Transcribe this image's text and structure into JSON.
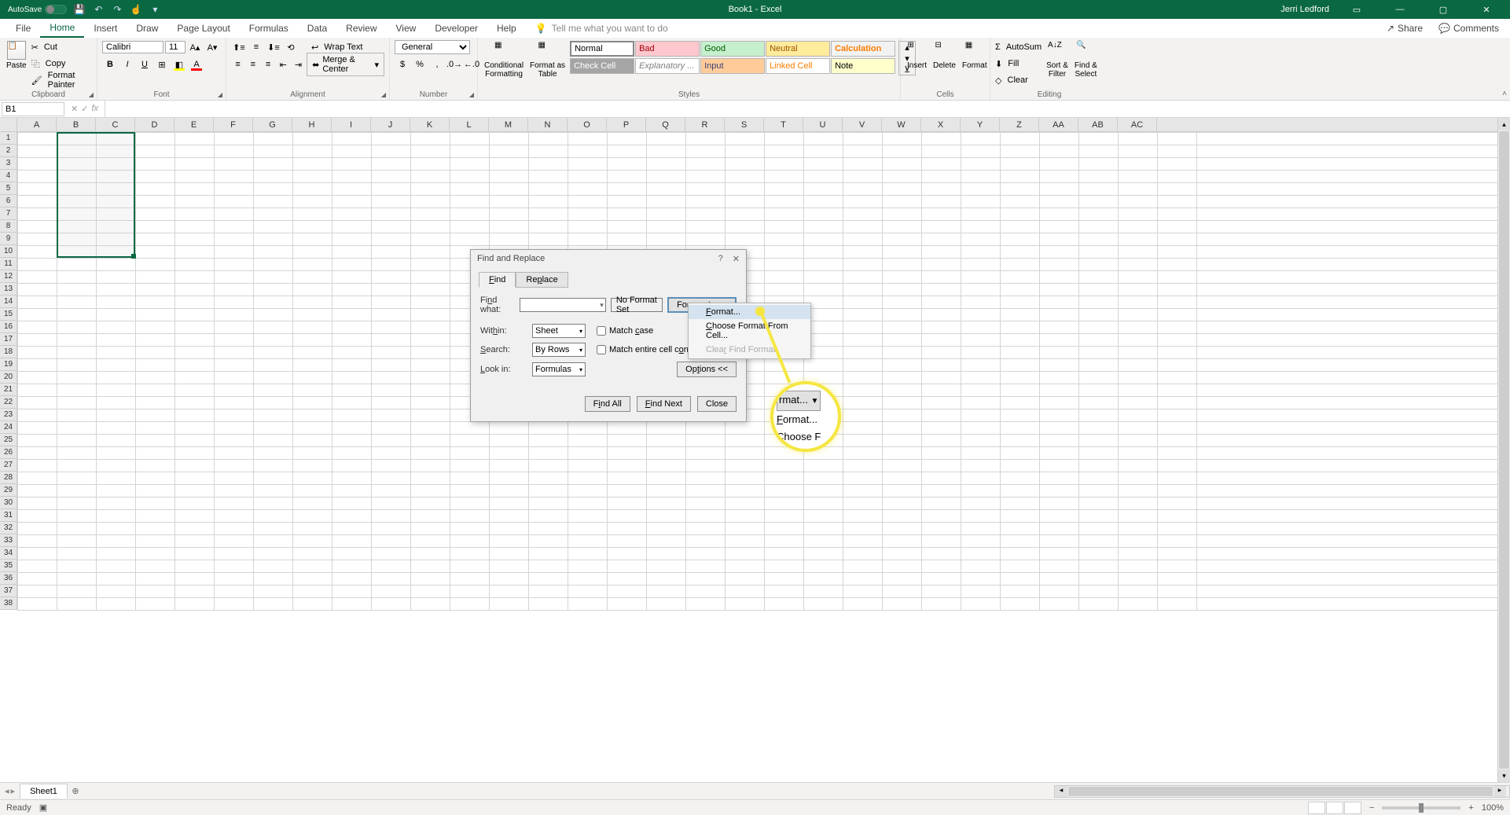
{
  "title_bar": {
    "autosave_label": "AutoSave",
    "autosave_state": "Off",
    "doc_title": "Book1 - Excel",
    "user_name": "Jerri Ledford"
  },
  "ribbon_tabs": {
    "file": "File",
    "home": "Home",
    "insert": "Insert",
    "draw": "Draw",
    "page_layout": "Page Layout",
    "formulas": "Formulas",
    "data": "Data",
    "review": "Review",
    "view": "View",
    "developer": "Developer",
    "help": "Help",
    "tell_me": "Tell me what you want to do",
    "share": "Share",
    "comments": "Comments"
  },
  "ribbon": {
    "clipboard": {
      "label": "Clipboard",
      "paste": "Paste",
      "cut": "Cut",
      "copy": "Copy",
      "format_painter": "Format Painter"
    },
    "font": {
      "label": "Font",
      "name": "Calibri",
      "size": "11"
    },
    "alignment": {
      "label": "Alignment",
      "wrap": "Wrap Text",
      "merge": "Merge & Center"
    },
    "number": {
      "label": "Number",
      "format": "General"
    },
    "styles": {
      "label": "Styles",
      "cond_fmt": "Conditional\nFormatting",
      "fmt_table": "Format as\nTable",
      "normal": "Normal",
      "bad": "Bad",
      "good": "Good",
      "neutral": "Neutral",
      "calculation": "Calculation",
      "check_cell": "Check Cell",
      "explanatory": "Explanatory ...",
      "input": "Input",
      "linked_cell": "Linked Cell",
      "note": "Note"
    },
    "cells": {
      "label": "Cells",
      "insert": "Insert",
      "delete": "Delete",
      "format": "Format"
    },
    "editing": {
      "label": "Editing",
      "autosum": "AutoSum",
      "fill": "Fill",
      "clear": "Clear",
      "sort": "Sort &\nFilter",
      "find": "Find &\nSelect"
    }
  },
  "name_box": "B1",
  "columns": [
    "A",
    "B",
    "C",
    "D",
    "E",
    "F",
    "G",
    "H",
    "I",
    "J",
    "K",
    "L",
    "M",
    "N",
    "O",
    "P",
    "Q",
    "R",
    "S",
    "T",
    "U",
    "V",
    "W",
    "X",
    "Y",
    "Z",
    "AA",
    "AB",
    "AC"
  ],
  "rows": [
    1,
    2,
    3,
    4,
    5,
    6,
    7,
    8,
    9,
    10,
    11,
    12,
    13,
    14,
    15,
    16,
    17,
    18,
    19,
    20,
    21,
    22,
    23,
    24,
    25,
    26,
    27,
    28,
    29,
    30,
    31,
    32,
    33,
    34,
    35,
    36,
    37,
    38
  ],
  "sheet_tabs": {
    "sheet1": "Sheet1"
  },
  "status": {
    "ready": "Ready",
    "zoom": "100%"
  },
  "dialog": {
    "title": "Find and Replace",
    "tab_find": "Find",
    "tab_replace": "Replace",
    "find_what": "Find what:",
    "no_format": "No Format Set",
    "format_btn": "Format...",
    "within": "Within:",
    "within_val": "Sheet",
    "search": "Search:",
    "search_val": "By Rows",
    "look_in": "Look in:",
    "look_in_val": "Formulas",
    "match_case": "Match case",
    "match_entire": "Match entire cell contents",
    "options": "Options <<",
    "find_all": "Find All",
    "find_next": "Find Next",
    "close": "Close"
  },
  "format_menu": {
    "format": "Format...",
    "choose": "Choose Format From Cell...",
    "clear": "Clear Find Format"
  },
  "zoom_callout": {
    "top": "rmat...",
    "mid": "Format...",
    "bot": "Choose F"
  }
}
